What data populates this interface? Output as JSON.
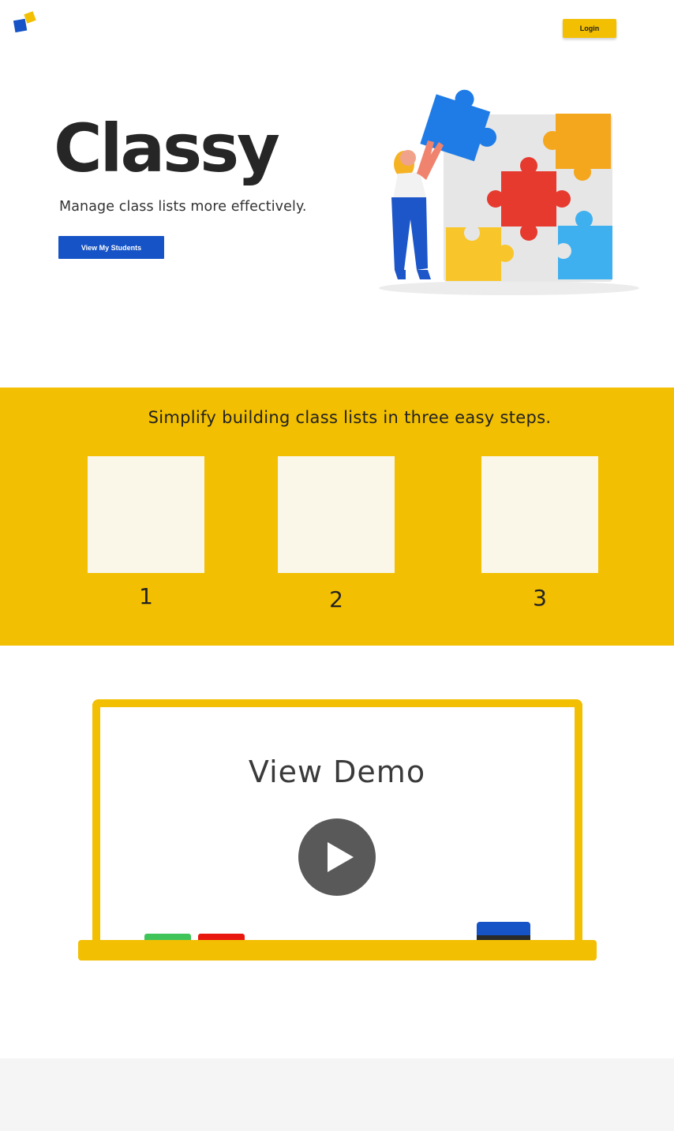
{
  "header": {
    "logo_icon": "classy-logo-icon",
    "login_label": "Login"
  },
  "hero": {
    "title": "Classy",
    "subtitle": "Manage class lists more effectively.",
    "cta_label": "View My Students",
    "illustration": "puzzle-illustration"
  },
  "steps": {
    "heading": "Simplify building class lists in three easy steps.",
    "items": [
      {
        "number": "1"
      },
      {
        "number": "2"
      },
      {
        "number": "3"
      }
    ]
  },
  "demo": {
    "title": "View Demo",
    "play_icon": "play-icon"
  },
  "colors": {
    "brand_blue": "#1553c6",
    "brand_yellow": "#f2bf02",
    "card_cream": "#faf6e8",
    "marker_green": "#3fc45a",
    "marker_red": "#e8180e",
    "footer_gray": "#f6f5f6"
  }
}
